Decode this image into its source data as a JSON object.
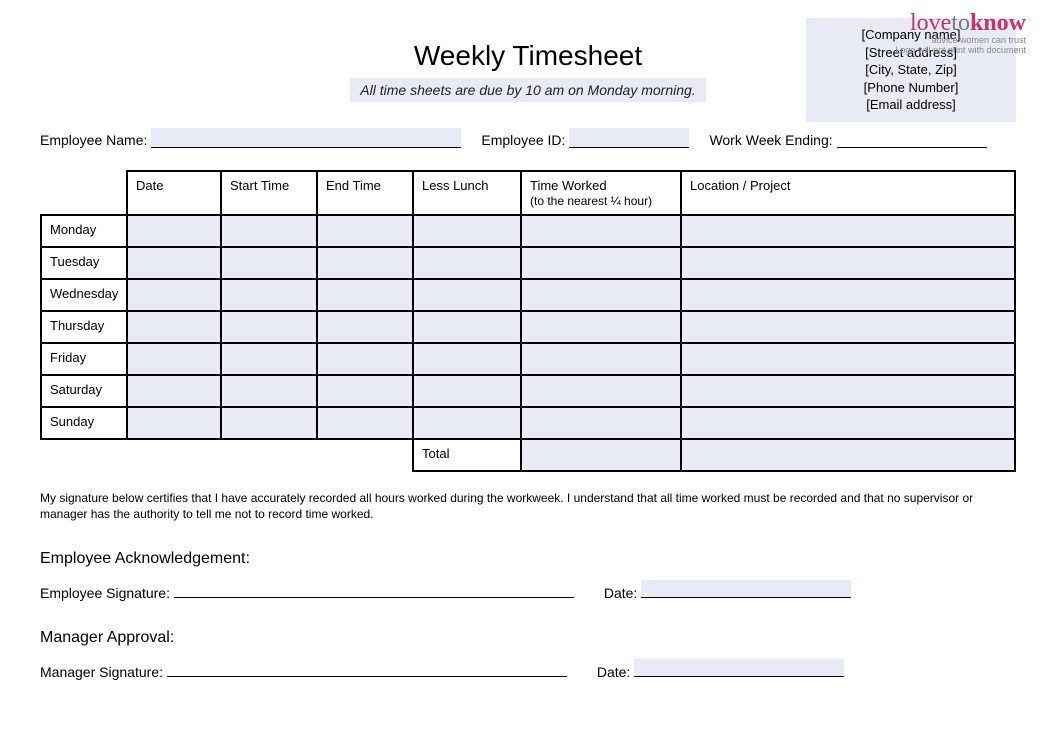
{
  "logo": {
    "love": "love",
    "to": "to",
    "know": "know",
    "tag": "advice women can trust",
    "note": "Logo will not print with document"
  },
  "company": {
    "name": "[Company name]",
    "street": "[Street address]",
    "csz": "[City, State, Zip]",
    "phone": "[Phone Number]",
    "email": "[Email address]"
  },
  "title": "Weekly Timesheet",
  "subtitle": "All time sheets are due by 10 am on Monday morning.",
  "labels": {
    "employee_name": "Employee Name:",
    "employee_id": "Employee ID:",
    "work_week_ending": "Work Week Ending:"
  },
  "table": {
    "headers": {
      "date": "Date",
      "start": "Start Time",
      "end": "End Time",
      "lunch": "Less Lunch",
      "worked": "Time Worked",
      "worked_sub": "(to the nearest ¼ hour)",
      "location": "Location / Project"
    },
    "days": [
      "Monday",
      "Tuesday",
      "Wednesday",
      "Thursday",
      "Friday",
      "Saturday",
      "Sunday"
    ],
    "total": "Total"
  },
  "certification": "My signature below certifies that I have accurately recorded all hours worked during the workweek. I understand that all time worked must be recorded and that no supervisor or manager has the authority to tell me not to record time worked.",
  "ack": {
    "heading": "Employee Acknowledgement:",
    "sig_label": "Employee Signature:",
    "date_label": "Date:"
  },
  "mgr": {
    "heading": "Manager Approval:",
    "sig_label": "Manager Signature:",
    "date_label": "Date:"
  }
}
